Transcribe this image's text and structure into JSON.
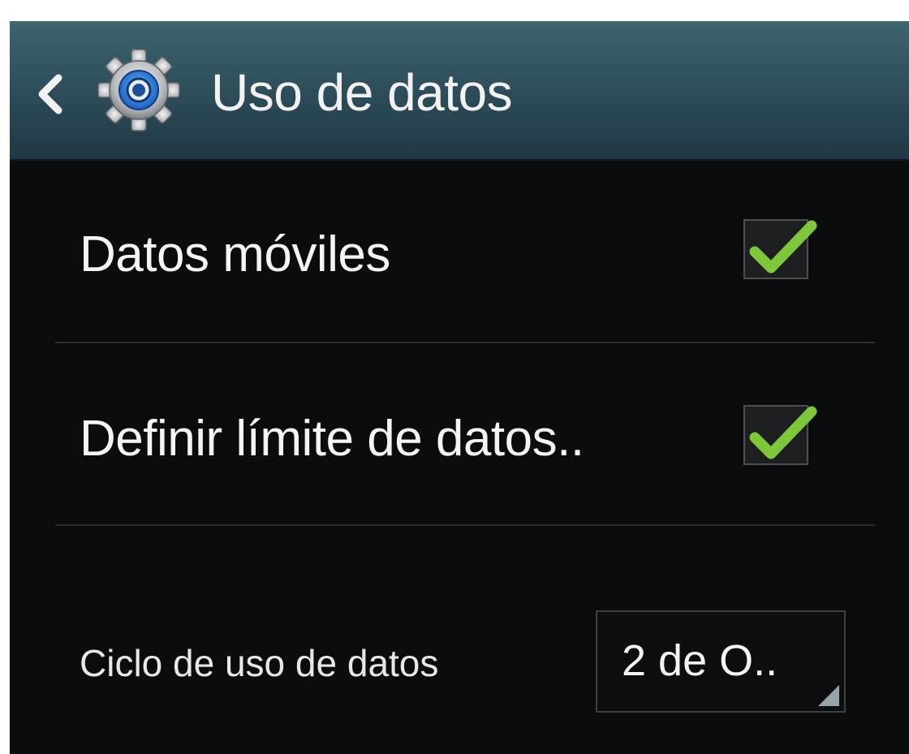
{
  "header": {
    "title": "Uso de datos",
    "back_icon": "chevron-left-icon",
    "settings_icon": "gear-icon"
  },
  "settings": {
    "mobile_data": {
      "label": "Datos móviles",
      "checked": true
    },
    "data_limit": {
      "label": "Definir límite de datos..",
      "checked": true
    },
    "usage_cycle": {
      "label": "Ciclo de uso de datos",
      "selected_value": "2 de O.."
    }
  },
  "colors": {
    "action_bar": "#2c4b58",
    "background": "#0b0c0d",
    "check_accent": "#7ec63a",
    "text": "#f4f4f4"
  }
}
